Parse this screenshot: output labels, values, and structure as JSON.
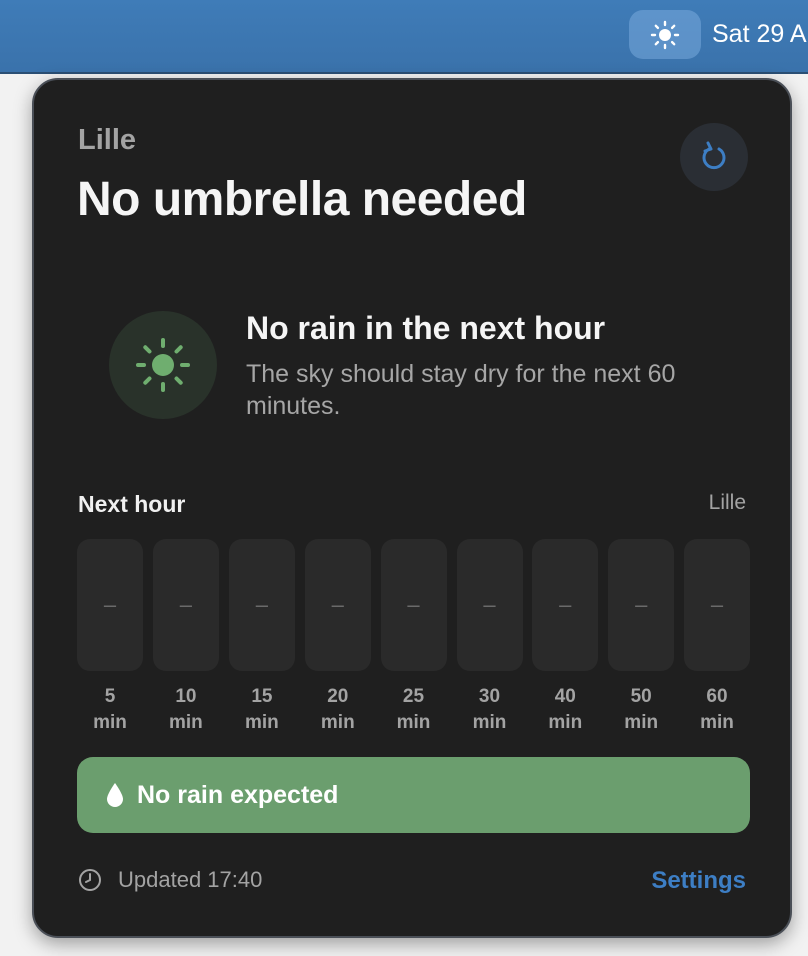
{
  "menubar": {
    "date_text": "Sat 29 A",
    "weather_icon": "sun-icon"
  },
  "panel": {
    "location": "Lille",
    "headline": "No umbrella needed",
    "refresh_icon": "refresh-icon",
    "summary": {
      "icon": "sun-icon",
      "title": "No rain in the next hour",
      "description": "The sky should stay dry for the next 60 minutes."
    },
    "forecast": {
      "title": "Next hour",
      "location": "Lille",
      "intervals": [
        {
          "value": "–",
          "label": "5",
          "unit": "min"
        },
        {
          "value": "–",
          "label": "10",
          "unit": "min"
        },
        {
          "value": "–",
          "label": "15",
          "unit": "min"
        },
        {
          "value": "–",
          "label": "20",
          "unit": "min"
        },
        {
          "value": "–",
          "label": "25",
          "unit": "min"
        },
        {
          "value": "–",
          "label": "30",
          "unit": "min"
        },
        {
          "value": "–",
          "label": "40",
          "unit": "min"
        },
        {
          "value": "–",
          "label": "50",
          "unit": "min"
        },
        {
          "value": "–",
          "label": "60",
          "unit": "min"
        }
      ]
    },
    "status": {
      "icon": "droplet-icon",
      "text": "No rain expected",
      "color": "#6b9e6e"
    },
    "footer": {
      "clock_icon": "clock-icon",
      "updated": "Updated 17:40",
      "settings_label": "Settings"
    }
  },
  "colors": {
    "panel_bg": "#1f1f1f",
    "menubar_bg": "#3a72ab",
    "accent": "#3d7ec4",
    "sun_green": "#6fae6f"
  }
}
